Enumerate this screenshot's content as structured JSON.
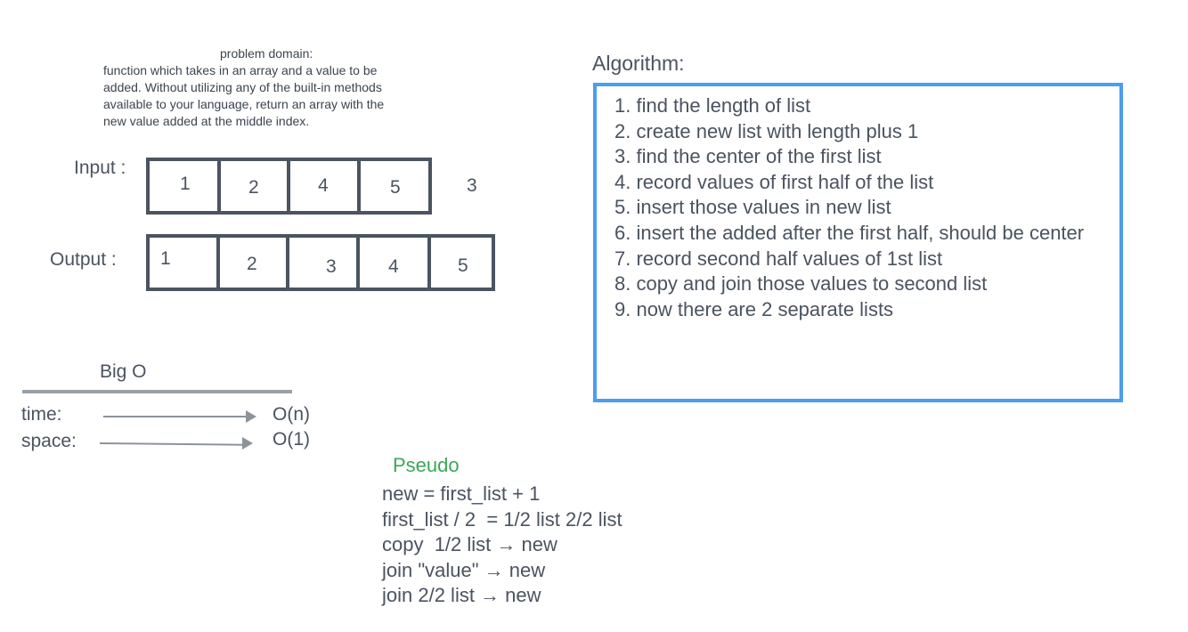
{
  "problem_domain": {
    "title": "problem domain:",
    "lines": [
      "function which takes in an array and a value to be",
      "added. Without utilizing any of the built-in methods",
      "available to your language, return an array with the",
      "new value added at the middle index."
    ]
  },
  "input": {
    "label": "Input :",
    "cells": [
      "1",
      "2",
      "4",
      "5"
    ],
    "value": "3"
  },
  "output": {
    "label": "Output :",
    "cells": [
      "1",
      "2",
      "3",
      "4",
      "5"
    ]
  },
  "algorithm": {
    "title": "Algorithm:",
    "steps": [
      "1. find the length of list",
      "2. create new list with length plus 1",
      "3. find the center of the first list",
      "4. record values of first half of the list",
      "5. insert those values in new list",
      "6. insert the added after the first half, should be center",
      "7. record second half values of 1st list",
      "8. copy and join those values to second list",
      "9. now there are 2 separate lists"
    ]
  },
  "big_o": {
    "title": "Big O",
    "time": {
      "label": "time:",
      "value": "O(n)"
    },
    "space": {
      "label": "space:",
      "value": "O(1)"
    }
  },
  "pseudo": {
    "title": "Pseudo",
    "lines": [
      "new = first_list + 1",
      "first_list / 2  = 1/2 list 2/2 list",
      "copy  1/2 list → new",
      "join \"value\" → new",
      "join 2/2 list → new"
    ]
  },
  "colors": {
    "algorithm_border": "#4a9df0",
    "pseudo_title": "#3aa856",
    "cell_border": "#4b5461"
  }
}
